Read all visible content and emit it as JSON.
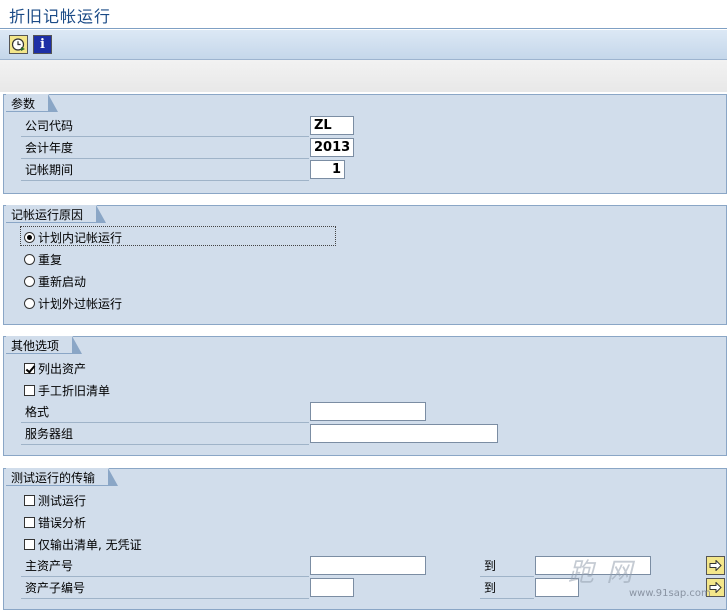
{
  "window": {
    "title": "折旧记帐运行"
  },
  "toolbar": {
    "execute_icon": "execute-clock-icon",
    "info_icon": "info-icon",
    "info_glyph": "i"
  },
  "params": {
    "title": "参数",
    "company_code_label": "公司代码",
    "company_code_value": "ZL",
    "fiscal_year_label": "会计年度",
    "fiscal_year_value": "2013",
    "posting_period_label": "记帐期间",
    "posting_period_value": "1"
  },
  "reason": {
    "title": "记帐运行原因",
    "options": [
      "计划内记帐运行",
      "重复",
      "重新启动",
      "计划外过帐运行"
    ],
    "selected": 0
  },
  "other": {
    "title": "其他选项",
    "list_assets_label": "列出资产",
    "list_assets_checked": true,
    "manual_depr_label": "手工折旧清单",
    "manual_depr_checked": false,
    "layout_label": "格式",
    "layout_value": "",
    "server_group_label": "服务器组",
    "server_group_value": ""
  },
  "test": {
    "title": "测试运行的传输",
    "test_run_label": "测试运行",
    "test_run_checked": false,
    "error_analysis_label": "错误分析",
    "error_analysis_checked": false,
    "list_only_label": "仅输出清单, 无凭证",
    "list_only_checked": false,
    "main_asset_label": "主资产号",
    "main_asset_from": "",
    "main_asset_to_label": "到",
    "main_asset_to": "",
    "subnumber_label": "资产子编号",
    "subnumber_from": "",
    "subnumber_to_label": "到",
    "subnumber_to": ""
  },
  "watermark": {
    "text": "跑 网",
    "url": "www.91sap.com"
  },
  "colors": {
    "group_bg": "#d1ddeb",
    "title": "#1a4a86",
    "button_yellow": "#f3e68a"
  }
}
